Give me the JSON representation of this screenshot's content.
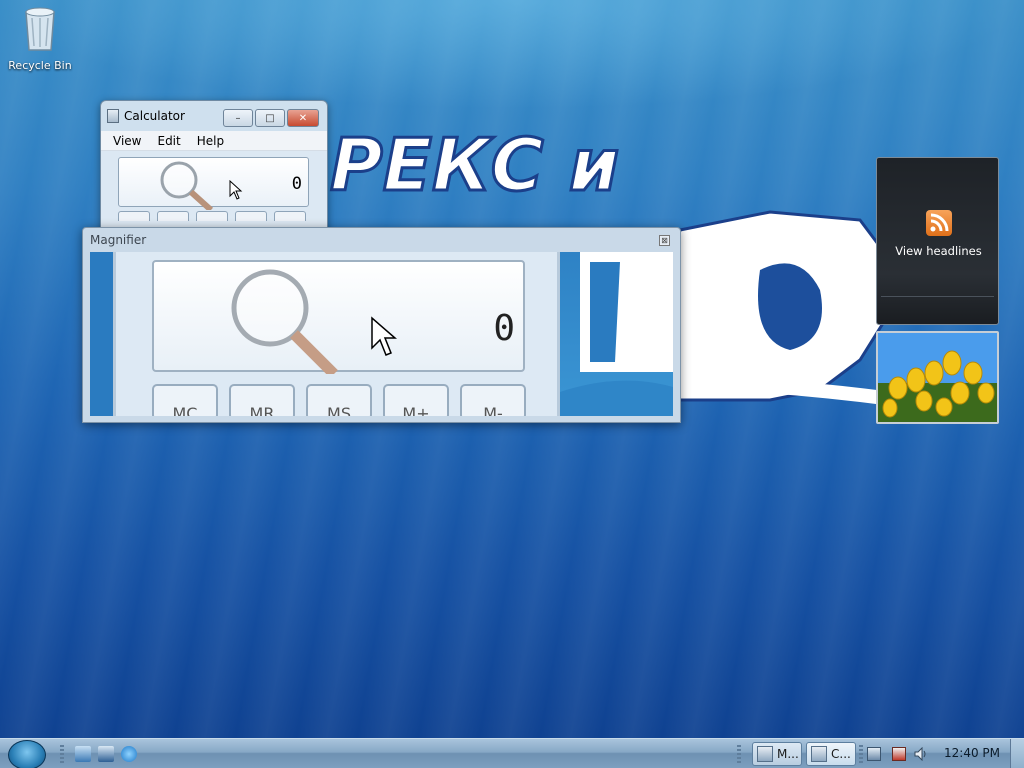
{
  "desktop": {
    "icons": [
      {
        "label": "Recycle Bin",
        "icon": "recycle-bin-icon"
      }
    ],
    "wallpaper_text": "РЕКС и"
  },
  "calculator": {
    "title": "Calculator",
    "menu": [
      "View",
      "Edit",
      "Help"
    ],
    "display_value": "0",
    "window_buttons": {
      "minimize": "–",
      "maximize": "□",
      "close": "✕"
    }
  },
  "magnifier": {
    "title": "Magnifier",
    "close_glyph": "⊠",
    "zoomed_display_value": "0",
    "zoomed_keys": [
      "MC",
      "MR",
      "MS",
      "M+",
      "M-"
    ]
  },
  "gadgets": {
    "feed_headlines": {
      "label": "View headlines",
      "icon": "rss-icon"
    },
    "slideshow": {
      "icon": "tulips-photo"
    }
  },
  "taskbar": {
    "quick_launch": [
      "show-desktop-icon",
      "switch-windows-icon",
      "internet-explorer-icon"
    ],
    "buttons": [
      {
        "label": "M...",
        "icon": "magnifier-app-icon",
        "active": false
      },
      {
        "label": "C...",
        "icon": "calculator-app-icon",
        "active": true
      }
    ],
    "tray": [
      "network-icon",
      "action-center-icon",
      "volume-icon"
    ],
    "clock": "12:40 PM"
  },
  "colors": {
    "accent_close": "#c74a30",
    "rss_orange": "#e0701a",
    "taskbar": "#87a8c6"
  }
}
